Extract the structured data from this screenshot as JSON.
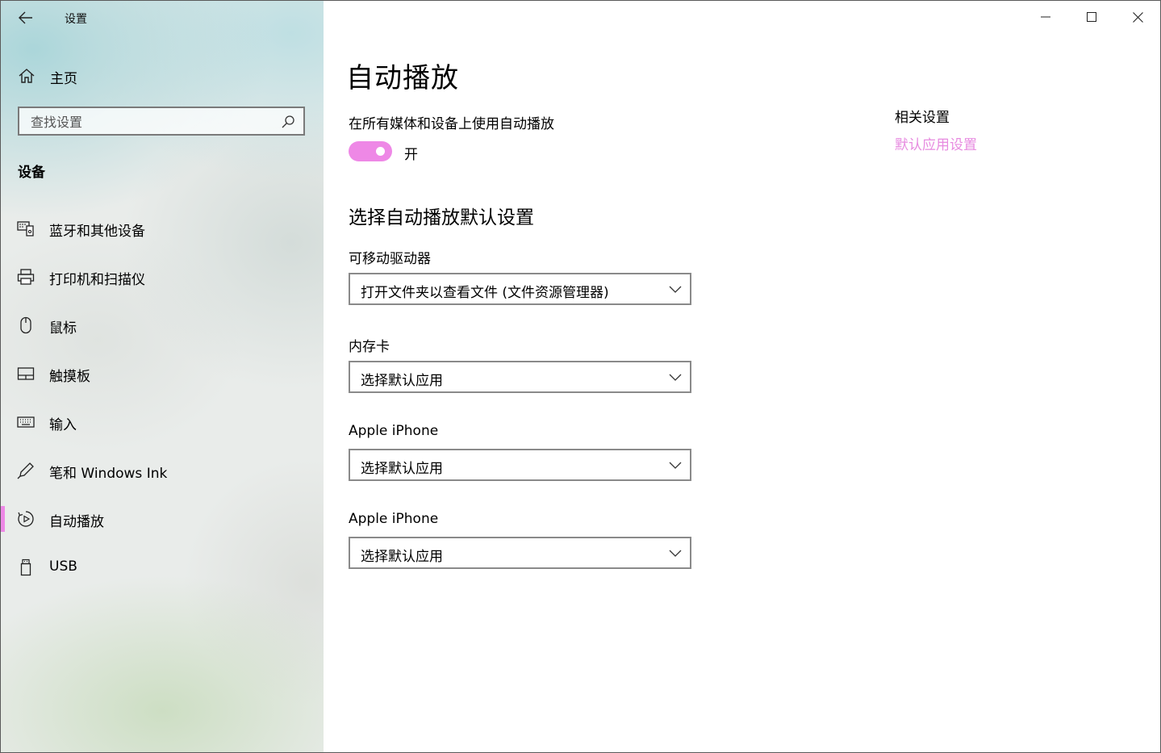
{
  "window": {
    "title": "设置"
  },
  "sidebar": {
    "home_label": "主页",
    "search_placeholder": "查找设置",
    "section_title": "设备",
    "items": [
      {
        "label": "蓝牙和其他设备",
        "icon": "bluetooth-devices-icon",
        "selected": false
      },
      {
        "label": "打印机和扫描仪",
        "icon": "printer-icon",
        "selected": false
      },
      {
        "label": "鼠标",
        "icon": "mouse-icon",
        "selected": false
      },
      {
        "label": "触摸板",
        "icon": "touchpad-icon",
        "selected": false
      },
      {
        "label": "输入",
        "icon": "keyboard-icon",
        "selected": false
      },
      {
        "label": "笔和 Windows Ink",
        "icon": "pen-icon",
        "selected": false
      },
      {
        "label": "自动播放",
        "icon": "autoplay-icon",
        "selected": true
      },
      {
        "label": "USB",
        "icon": "usb-icon",
        "selected": false
      }
    ]
  },
  "main": {
    "title": "自动播放",
    "toggle": {
      "label": "在所有媒体和设备上使用自动播放",
      "state": "开",
      "on": true
    },
    "defaults_title": "选择自动播放默认设置",
    "fields": [
      {
        "label": "可移动驱动器",
        "value": "打开文件夹以查看文件 (文件资源管理器)"
      },
      {
        "label": "内存卡",
        "value": "选择默认应用"
      },
      {
        "label": "Apple iPhone",
        "value": "选择默认应用"
      },
      {
        "label": "Apple iPhone",
        "value": "选择默认应用"
      }
    ]
  },
  "related": {
    "title": "相关设置",
    "link": "默认应用设置"
  },
  "colors": {
    "accent": "#ee88e6",
    "link": "#e78be0"
  }
}
